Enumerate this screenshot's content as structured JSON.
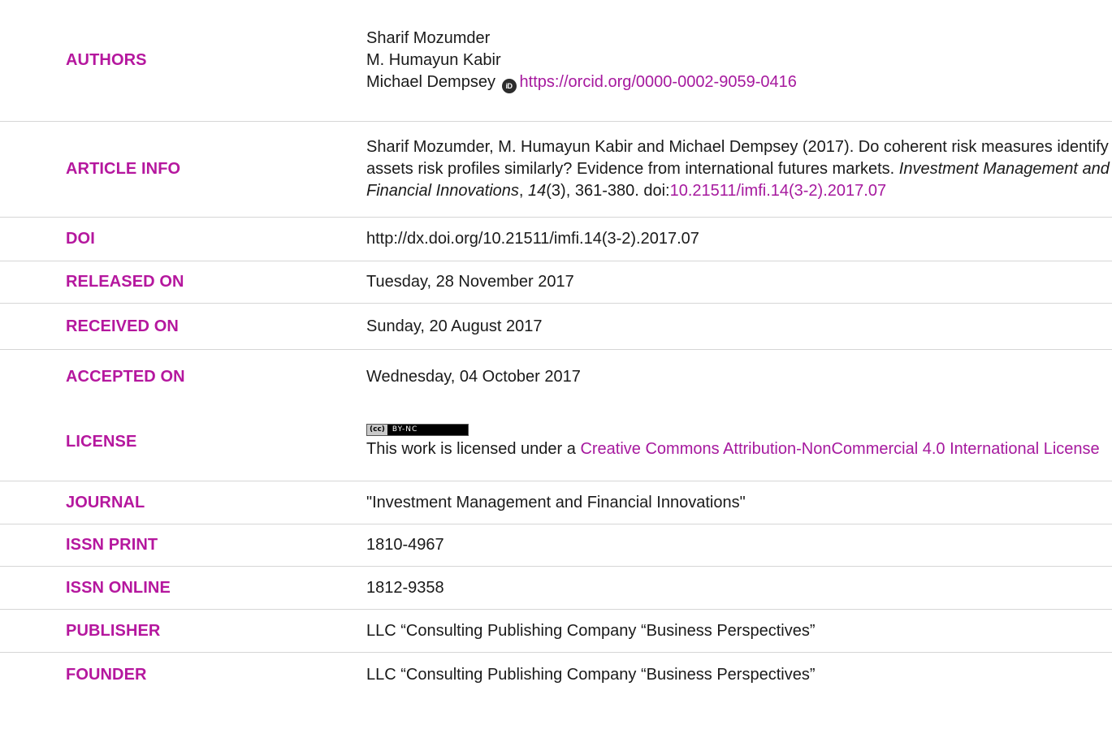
{
  "rows": {
    "authors": {
      "label": "AUTHORS",
      "names": [
        "Sharif Mozumder",
        "M. Humayun Kabir",
        "Michael Dempsey"
      ],
      "orcid_url": "https://orcid.org/0000-0002-9059-0416"
    },
    "article_info": {
      "label": "ARTICLE INFO",
      "citation_prefix": "Sharif Mozumder, M. Humayun Kabir and Michael Dempsey (2017). Do coherent risk measures identify assets risk profiles similarly? Evidence from international futures markets. ",
      "journal_italic": "Investment Management and Financial Innovations",
      "sep1": ", ",
      "volume_italic": "14",
      "issue_pages": "(3), 361-380. doi:",
      "doi_link": "10.21511/imfi.14(3-2).2017.07"
    },
    "doi": {
      "label": "DOI",
      "value": "http://dx.doi.org/10.21511/imfi.14(3-2).2017.07"
    },
    "released_on": {
      "label": "RELEASED ON",
      "value": "Tuesday, 28 November 2017"
    },
    "received_on": {
      "label": "RECEIVED ON",
      "value": "Sunday, 20 August 2017"
    },
    "accepted_on": {
      "label": "ACCEPTED ON",
      "value": "Wednesday, 04 October 2017"
    },
    "license": {
      "label": "LICENSE",
      "badge_cc": "(cc)",
      "badge_terms": "BY-NC",
      "text_prefix": "This work is licensed under a ",
      "license_link": "Creative Commons Attribution-NonCommercial 4.0 International License"
    },
    "journal": {
      "label": "JOURNAL",
      "value": "\"Investment Management and Financial Innovations\""
    },
    "issn_print": {
      "label": "ISSN PRINT",
      "value": "1810-4967"
    },
    "issn_online": {
      "label": "ISSN ONLINE",
      "value": "1812-9358"
    },
    "publisher": {
      "label": "PUBLISHER",
      "value": "LLC “Consulting Publishing Company “Business Perspectives”"
    },
    "founder": {
      "label": "FOUNDER",
      "value": "LLC “Consulting Publishing Company “Business Perspectives”"
    }
  },
  "colors": {
    "label": "#b5179e",
    "link": "#a6199e",
    "divider": "#d6d6d6"
  }
}
